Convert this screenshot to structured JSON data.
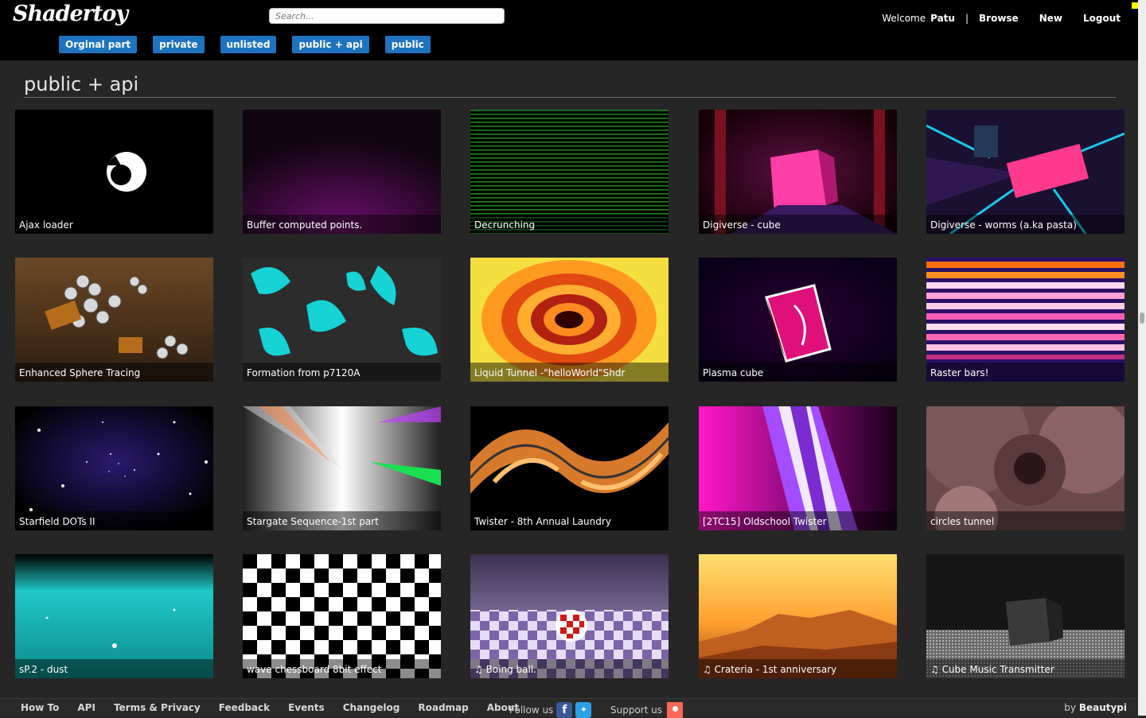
{
  "header": {
    "logo": "Shadertoy",
    "search_placeholder": "Search...",
    "welcome": "Welcome",
    "username": "Patu",
    "separator": "|",
    "nav": [
      "Browse",
      "New",
      "Logout"
    ]
  },
  "tabs": [
    "Orginal part",
    "private",
    "unlisted",
    "public + api",
    "public"
  ],
  "section_title": "public + api",
  "shaders": [
    {
      "title": "Ajax loader"
    },
    {
      "title": "Buffer computed points."
    },
    {
      "title": "Decrunching"
    },
    {
      "title": "Digiverse - cube"
    },
    {
      "title": "Digiverse - worms (a.ka pasta)"
    },
    {
      "title": "Enhanced Sphere Tracing"
    },
    {
      "title": "Formation from p7120A"
    },
    {
      "title": "Liquid Tunnel -\"helloWorld\"Shdr"
    },
    {
      "title": "Plasma cube"
    },
    {
      "title": "Raster bars!"
    },
    {
      "title": "Starfield DOTs II"
    },
    {
      "title": "Stargate Sequence-1st part"
    },
    {
      "title": "Twister - 8th Annual Laundry"
    },
    {
      "title": "[2TC15] Oldschool Twister"
    },
    {
      "title": "circles tunnel"
    },
    {
      "title": "sP.2 - dust"
    },
    {
      "title": "wave chessboard 8bit effect"
    },
    {
      "title": "♫ Boing ball."
    },
    {
      "title": "♫ Crateria - 1st anniversary"
    },
    {
      "title": "♫ Cube Music Transmitter"
    }
  ],
  "footer": {
    "links": [
      "How To",
      "API",
      "Terms & Privacy",
      "Feedback",
      "Events",
      "Changelog",
      "Roadmap",
      "About"
    ],
    "follow_label": "Follow us",
    "support_label": "Support us",
    "by_label": "by",
    "by_name": "Beautypi"
  },
  "colors": {
    "tab_bg": "#1e73be",
    "header_bg": "#000000",
    "page_bg": "#262626"
  }
}
